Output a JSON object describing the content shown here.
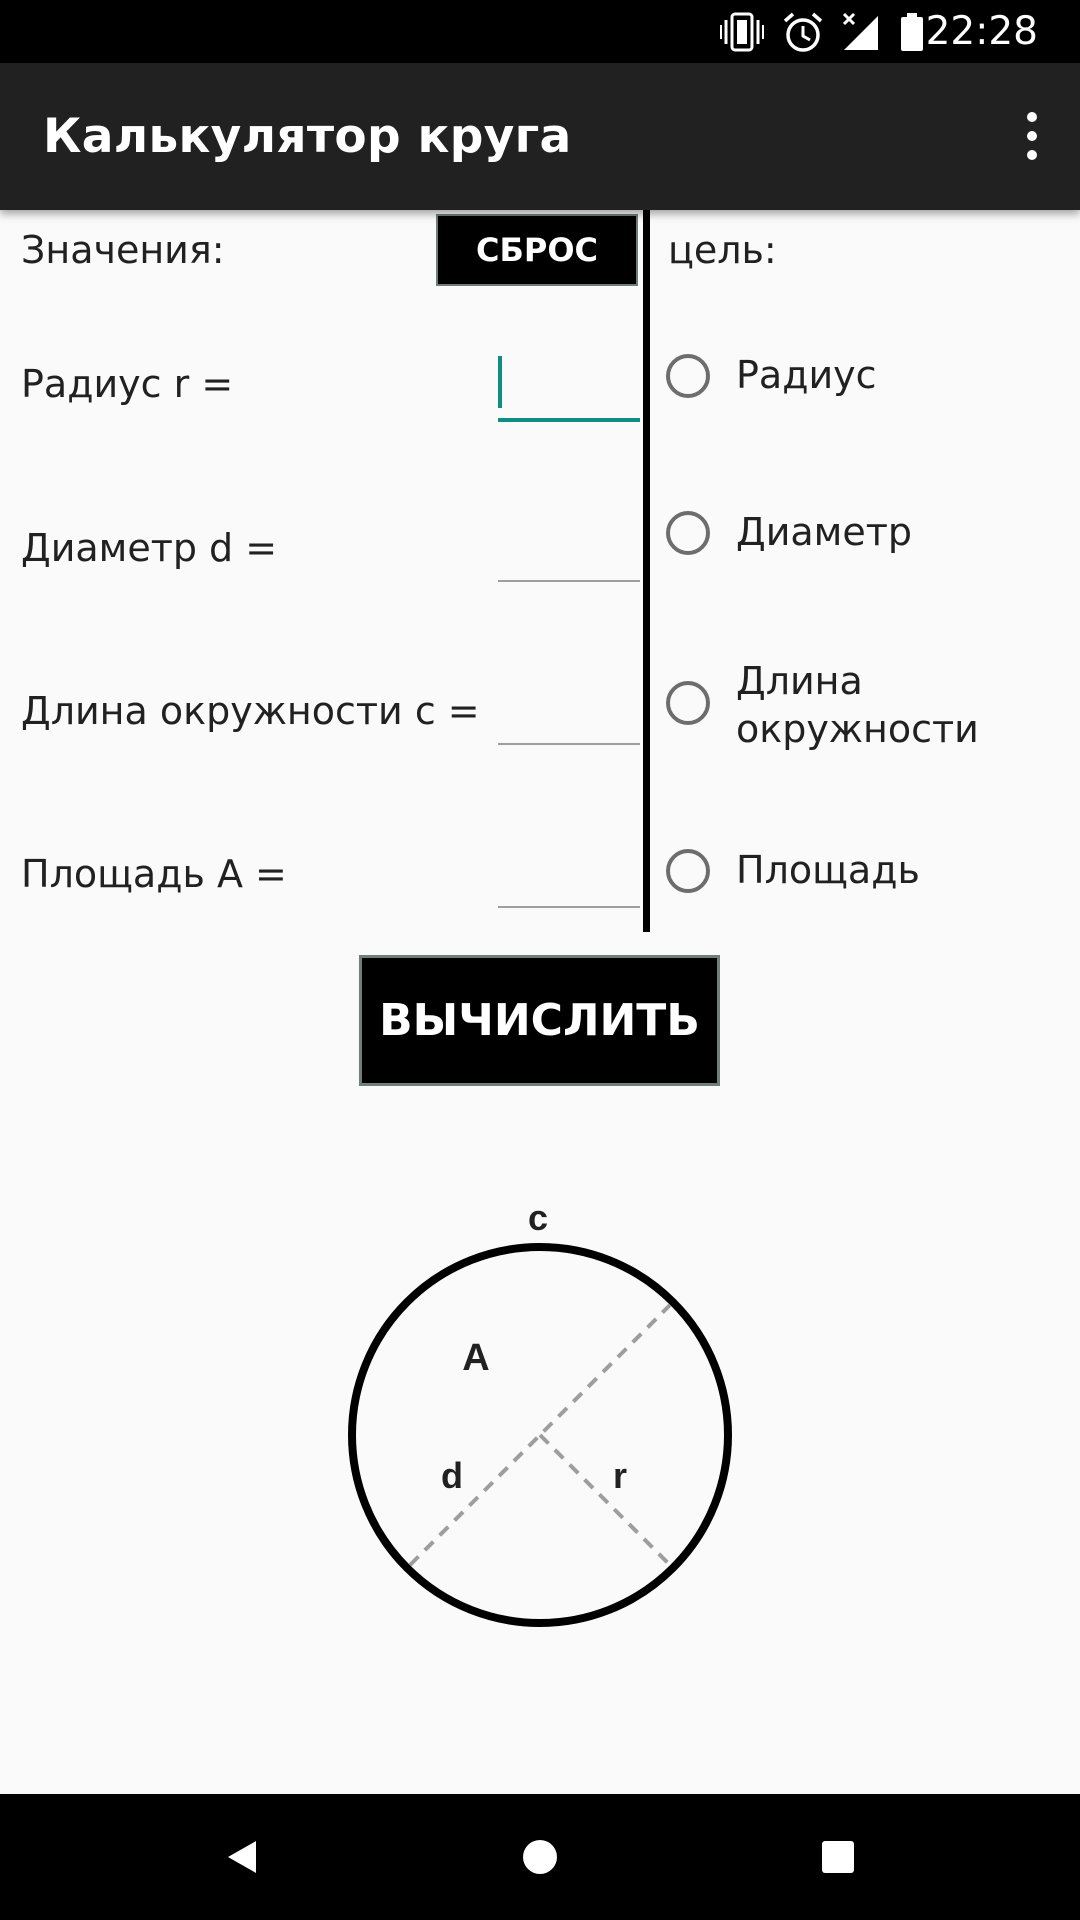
{
  "status_bar": {
    "time": "22:28",
    "icons": [
      "vibrate-icon",
      "alarm-icon",
      "signal-off-icon",
      "battery-icon"
    ]
  },
  "app_bar": {
    "title": "Калькулятор круга",
    "menu_icon": "overflow-menu-icon"
  },
  "inputs": {
    "header": "Значения:",
    "reset_label": "СБРОС",
    "radius_label": "Радиус r =",
    "radius_value": "",
    "diameter_label": "Диаметр d =",
    "diameter_value": "",
    "circumference_label": "Длина окружности c =",
    "circumference_value": "",
    "area_label": "Площадь A =",
    "area_value": ""
  },
  "target": {
    "header": "цель:",
    "options": [
      {
        "label": "Радиус",
        "selected": false
      },
      {
        "label": "Диаметр",
        "selected": false
      },
      {
        "label_line1": "Длина",
        "label_line2": "окружности",
        "selected": false
      },
      {
        "label": "Площадь",
        "selected": false
      }
    ]
  },
  "calculate_label": "ВЫЧИСЛИТЬ",
  "diagram": {
    "circumference_label": "c",
    "area_label": "A",
    "diameter_label": "d",
    "radius_label": "r"
  },
  "nav_bar": {
    "back_icon": "back-icon",
    "home_icon": "home-icon",
    "recents_icon": "recents-icon"
  },
  "colors": {
    "accent": "#0f8f84",
    "app_bar": "#212121",
    "button_bg": "#000000",
    "background": "#fafafa"
  }
}
